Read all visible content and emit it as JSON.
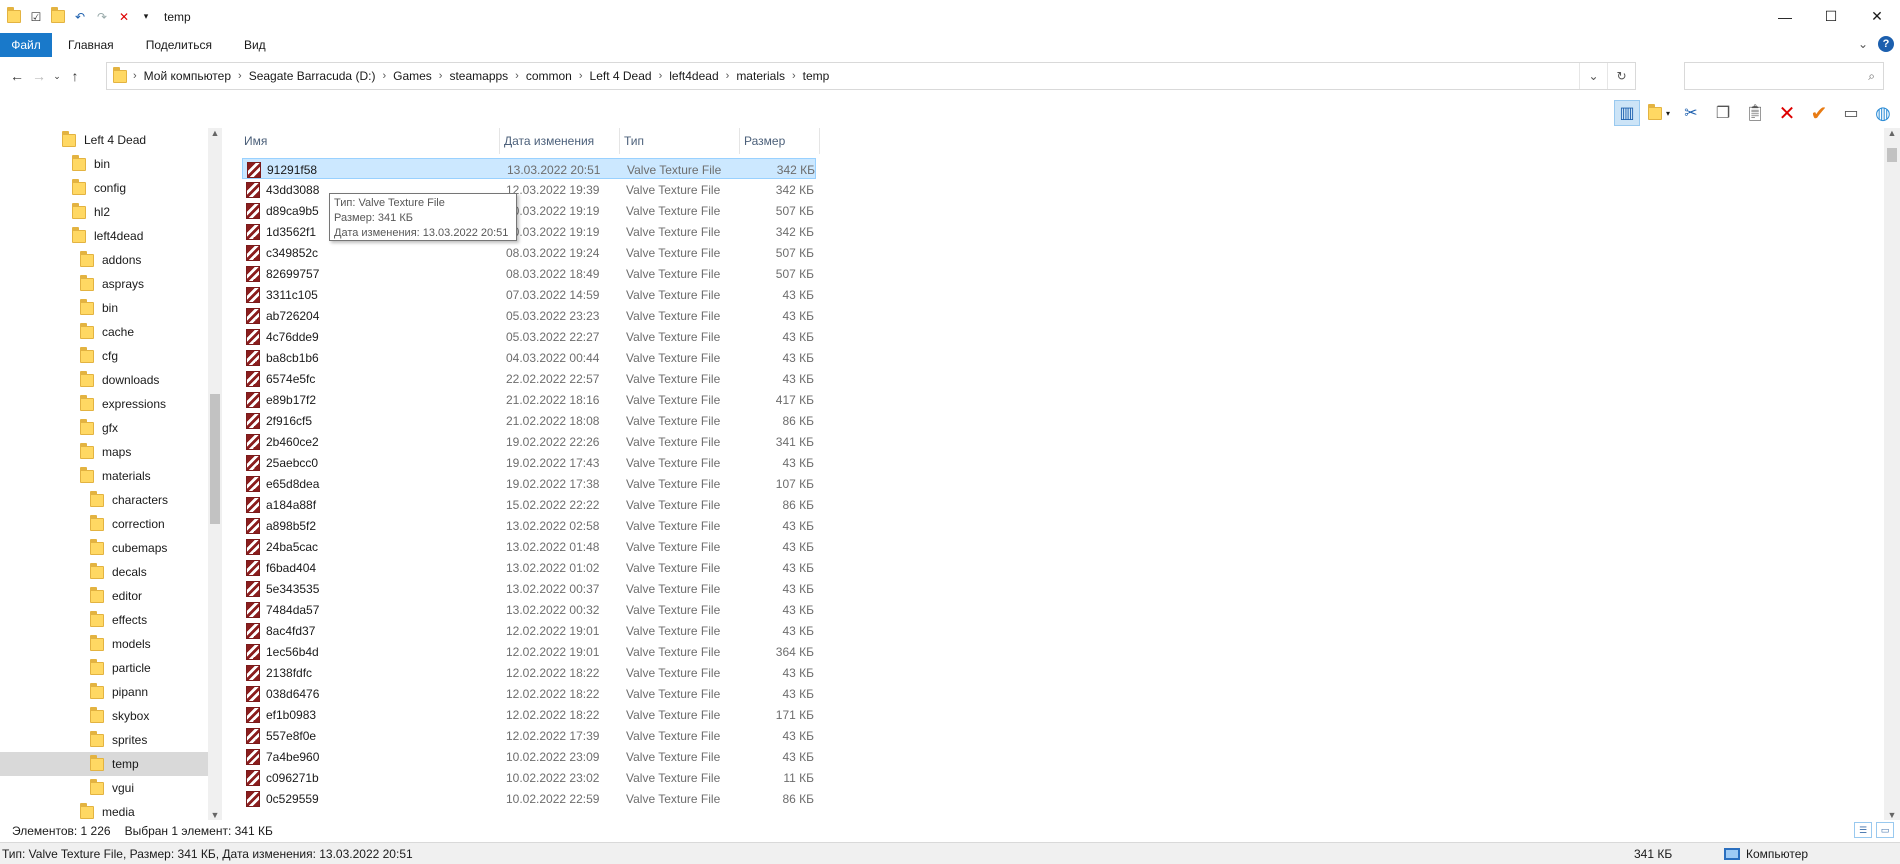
{
  "window": {
    "title": "temp",
    "minimize_glyph": "—",
    "maximize_glyph": "☐",
    "close_glyph": "✕"
  },
  "ribbon": {
    "tabs": [
      "Файл",
      "Главная",
      "Поделиться",
      "Вид"
    ],
    "collapse_glyph": "⌄",
    "help_glyph": "?"
  },
  "address": {
    "crumbs": [
      "Мой компьютер",
      "Seagate Barracuda (D:)",
      "Games",
      "steamapps",
      "common",
      "Left 4 Dead",
      "left4dead",
      "materials",
      "temp"
    ],
    "search_placeholder": ""
  },
  "tree": {
    "items": [
      {
        "label": "Left 4 Dead",
        "level": 0
      },
      {
        "label": "bin",
        "level": 1
      },
      {
        "label": "config",
        "level": 1
      },
      {
        "label": "hl2",
        "level": 1
      },
      {
        "label": "left4dead",
        "level": 1
      },
      {
        "label": "addons",
        "level": 2
      },
      {
        "label": "asprays",
        "level": 2
      },
      {
        "label": "bin",
        "level": 2
      },
      {
        "label": "cache",
        "level": 2
      },
      {
        "label": "cfg",
        "level": 2
      },
      {
        "label": "downloads",
        "level": 2
      },
      {
        "label": "expressions",
        "level": 2
      },
      {
        "label": "gfx",
        "level": 2
      },
      {
        "label": "maps",
        "level": 2
      },
      {
        "label": "materials",
        "level": 2
      },
      {
        "label": "characters",
        "level": 3
      },
      {
        "label": "correction",
        "level": 3
      },
      {
        "label": "cubemaps",
        "level": 3
      },
      {
        "label": "decals",
        "level": 3
      },
      {
        "label": "editor",
        "level": 3
      },
      {
        "label": "effects",
        "level": 3
      },
      {
        "label": "models",
        "level": 3
      },
      {
        "label": "particle",
        "level": 3
      },
      {
        "label": "pipann",
        "level": 3
      },
      {
        "label": "skybox",
        "level": 3
      },
      {
        "label": "sprites",
        "level": 3
      },
      {
        "label": "temp",
        "level": 3,
        "selected": true
      },
      {
        "label": "vgui",
        "level": 3
      },
      {
        "label": "media",
        "level": 2
      }
    ]
  },
  "list": {
    "columns": {
      "name": "Имя",
      "date": "Дата изменения",
      "type": "Тип",
      "size": "Размер"
    },
    "rows": [
      {
        "name": "91291f58",
        "date": "13.03.2022 20:51",
        "type": "Valve Texture File",
        "size": "342 КБ",
        "selected": true
      },
      {
        "name": "43dd3088",
        "date": "12.03.2022 19:39",
        "type": "Valve Texture File",
        "size": "342 КБ"
      },
      {
        "name": "d89ca9b5",
        "date": "10.03.2022 19:19",
        "type": "Valve Texture File",
        "size": "507 КБ"
      },
      {
        "name": "1d3562f1",
        "date": "10.03.2022 19:19",
        "type": "Valve Texture File",
        "size": "342 КБ"
      },
      {
        "name": "c349852c",
        "date": "08.03.2022 19:24",
        "type": "Valve Texture File",
        "size": "507 КБ"
      },
      {
        "name": "82699757",
        "date": "08.03.2022 18:49",
        "type": "Valve Texture File",
        "size": "507 КБ"
      },
      {
        "name": "3311c105",
        "date": "07.03.2022 14:59",
        "type": "Valve Texture File",
        "size": "43 КБ"
      },
      {
        "name": "ab726204",
        "date": "05.03.2022 23:23",
        "type": "Valve Texture File",
        "size": "43 КБ"
      },
      {
        "name": "4c76dde9",
        "date": "05.03.2022 22:27",
        "type": "Valve Texture File",
        "size": "43 КБ"
      },
      {
        "name": "ba8cb1b6",
        "date": "04.03.2022 00:44",
        "type": "Valve Texture File",
        "size": "43 КБ"
      },
      {
        "name": "6574e5fc",
        "date": "22.02.2022 22:57",
        "type": "Valve Texture File",
        "size": "43 КБ"
      },
      {
        "name": "e89b17f2",
        "date": "21.02.2022 18:16",
        "type": "Valve Texture File",
        "size": "417 КБ"
      },
      {
        "name": "2f916cf5",
        "date": "21.02.2022 18:08",
        "type": "Valve Texture File",
        "size": "86 КБ"
      },
      {
        "name": "2b460ce2",
        "date": "19.02.2022 22:26",
        "type": "Valve Texture File",
        "size": "341 КБ"
      },
      {
        "name": "25aebcc0",
        "date": "19.02.2022 17:43",
        "type": "Valve Texture File",
        "size": "43 КБ"
      },
      {
        "name": "e65d8dea",
        "date": "19.02.2022 17:38",
        "type": "Valve Texture File",
        "size": "107 КБ"
      },
      {
        "name": "a184a88f",
        "date": "15.02.2022 22:22",
        "type": "Valve Texture File",
        "size": "86 КБ"
      },
      {
        "name": "a898b5f2",
        "date": "13.02.2022 02:58",
        "type": "Valve Texture File",
        "size": "43 КБ"
      },
      {
        "name": "24ba5cac",
        "date": "13.02.2022 01:48",
        "type": "Valve Texture File",
        "size": "43 КБ"
      },
      {
        "name": "f6bad404",
        "date": "13.02.2022 01:02",
        "type": "Valve Texture File",
        "size": "43 КБ"
      },
      {
        "name": "5e343535",
        "date": "13.02.2022 00:37",
        "type": "Valve Texture File",
        "size": "43 КБ"
      },
      {
        "name": "7484da57",
        "date": "13.02.2022 00:32",
        "type": "Valve Texture File",
        "size": "43 КБ"
      },
      {
        "name": "8ac4fd37",
        "date": "12.02.2022 19:01",
        "type": "Valve Texture File",
        "size": "43 КБ"
      },
      {
        "name": "1ec56b4d",
        "date": "12.02.2022 19:01",
        "type": "Valve Texture File",
        "size": "364 КБ"
      },
      {
        "name": "2138fdfc",
        "date": "12.02.2022 18:22",
        "type": "Valve Texture File",
        "size": "43 КБ"
      },
      {
        "name": "038d6476",
        "date": "12.02.2022 18:22",
        "type": "Valve Texture File",
        "size": "43 КБ"
      },
      {
        "name": "ef1b0983",
        "date": "12.02.2022 18:22",
        "type": "Valve Texture File",
        "size": "171 КБ"
      },
      {
        "name": "557e8f0e",
        "date": "12.02.2022 17:39",
        "type": "Valve Texture File",
        "size": "43 КБ"
      },
      {
        "name": "7a4be960",
        "date": "10.02.2022 23:09",
        "type": "Valve Texture File",
        "size": "43 КБ"
      },
      {
        "name": "c096271b",
        "date": "10.02.2022 23:02",
        "type": "Valve Texture File",
        "size": "11 КБ"
      },
      {
        "name": "0c529559",
        "date": "10.02.2022 22:59",
        "type": "Valve Texture File",
        "size": "86 КБ"
      }
    ]
  },
  "tooltip": {
    "line1": "Тип: Valve Texture File",
    "line2": "Размер: 341 КБ",
    "line3": "Дата изменения: 13.03.2022 20:51"
  },
  "status": {
    "items_count": "Элементов: 1 226",
    "selected": "Выбран 1 элемент: 341 КБ",
    "detail": "Тип: Valve Texture File, Размер: 341 КБ, Дата изменения: 13.03.2022 20:51",
    "size": "341 КБ",
    "computer": "Компьютер"
  }
}
